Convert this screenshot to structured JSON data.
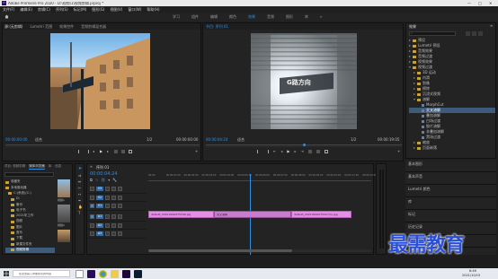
{
  "title_bar": {
    "title": "Adobe Premiere Pro 2020 - D:\\视频\\1\\视频剪辑.prproj *",
    "minimize": "—",
    "maximize": "□",
    "close": "✕"
  },
  "menu": [
    "文件(F)",
    "编辑(E)",
    "剪辑(C)",
    "序列(S)",
    "标记(M)",
    "图形(G)",
    "视图(V)",
    "窗口(W)",
    "帮助(H)"
  ],
  "workspaces": [
    "学习",
    "组件",
    "编辑",
    "颜色",
    "效果",
    "音频",
    "图形",
    "库",
    "»"
  ],
  "active_workspace": "效果",
  "source_panel": {
    "tabs": [
      "源:(无剪辑)",
      "Lumetri 范围",
      "效果控件",
      "音频剪辑混合器"
    ],
    "clip_label": "源:(无剪辑)",
    "timecode": "00:00:00:00",
    "fit": "适合",
    "duration": "00:00:00:00",
    "ratio": "1/2"
  },
  "program_panel": {
    "tab": "节目: 序列 01",
    "timecode": "00:00:04:24",
    "fit": "适合",
    "ratio": "1/2",
    "duration": "00:00:19:05",
    "sign_text": "G路方向"
  },
  "effects_panel": {
    "title": "效果",
    "items": [
      {
        "label": "预设",
        "indent": 0,
        "type": "folder"
      },
      {
        "label": "Lumetri 预设",
        "indent": 0,
        "type": "folder"
      },
      {
        "label": "音频效果",
        "indent": 0,
        "type": "folder"
      },
      {
        "label": "音频过渡",
        "indent": 0,
        "type": "folder"
      },
      {
        "label": "视频效果",
        "indent": 0,
        "type": "folder"
      },
      {
        "label": "视频过渡",
        "indent": 0,
        "type": "folder",
        "open": true
      },
      {
        "label": "3D 运动",
        "indent": 1,
        "type": "folder"
      },
      {
        "label": "内滑",
        "indent": 1,
        "type": "folder"
      },
      {
        "label": "划像",
        "indent": 1,
        "type": "folder"
      },
      {
        "label": "擦除",
        "indent": 1,
        "type": "folder"
      },
      {
        "label": "沉浸式视频",
        "indent": 1,
        "type": "folder"
      },
      {
        "label": "溶解",
        "indent": 1,
        "type": "folder",
        "open": true
      },
      {
        "label": "MorphCut",
        "indent": 2,
        "type": "item"
      },
      {
        "label": "交叉溶解",
        "indent": 2,
        "type": "item",
        "selected": true
      },
      {
        "label": "叠加溶解",
        "indent": 2,
        "type": "item"
      },
      {
        "label": "白场过渡",
        "indent": 2,
        "type": "item"
      },
      {
        "label": "胶片溶解",
        "indent": 2,
        "type": "item"
      },
      {
        "label": "非叠加溶解",
        "indent": 2,
        "type": "item"
      },
      {
        "label": "黑场过渡",
        "indent": 2,
        "type": "item"
      },
      {
        "label": "缩放",
        "indent": 1,
        "type": "folder"
      },
      {
        "label": "页面剥落",
        "indent": 1,
        "type": "folder"
      }
    ],
    "sections": [
      "基本图形",
      "基本声音",
      "Lumetri 颜色",
      "库",
      "标记",
      "历史记录",
      "信息"
    ]
  },
  "project_panel": {
    "tabs": [
      "项目: 视频剪辑",
      "媒体浏览器",
      "库",
      "信息"
    ],
    "active_tab": "媒体浏览器",
    "drives": [
      "收藏夹",
      "本地驱动器",
      "C:(系统)(C:)",
      "D:",
      "备份",
      "电子书",
      "2021年工作",
      "视频",
      "图片",
      "音乐",
      "下载",
      "新建文件夹",
      "视频剪辑"
    ],
    "thumb_labels": [
      "视频1",
      "视频2",
      "视频3"
    ]
  },
  "timeline": {
    "tab": "序列 01",
    "timecode": "00:00:04:24",
    "ruler": [
      "00:00",
      "00:00:01:00",
      "00:00:02:00",
      "00:00:03:00",
      "00:00:04:00",
      "00:00:05:00",
      "00:00:06:00",
      "00:00:07:00",
      "00:00:08:00",
      "00:00:09:00",
      "00:00:10:00",
      "00:00:11:00",
      "00:00:12:00"
    ],
    "tracks": [
      "V3",
      "V2",
      "V1",
      "A1",
      "A2",
      "A3"
    ],
    "clip1": "default_20210910075349.jpg",
    "transition": "交叉溶解",
    "clip2": "default_20210910075417(1).jpg"
  },
  "watermark": "最需教育",
  "taskbar": {
    "search": "在这里输入你要搜索的内容",
    "time": "8:46",
    "date": "2021/10/15"
  },
  "colors": {
    "accent": "#2f8fe6",
    "clip": "#e58ee8",
    "watermark": "#2a4fd6"
  }
}
